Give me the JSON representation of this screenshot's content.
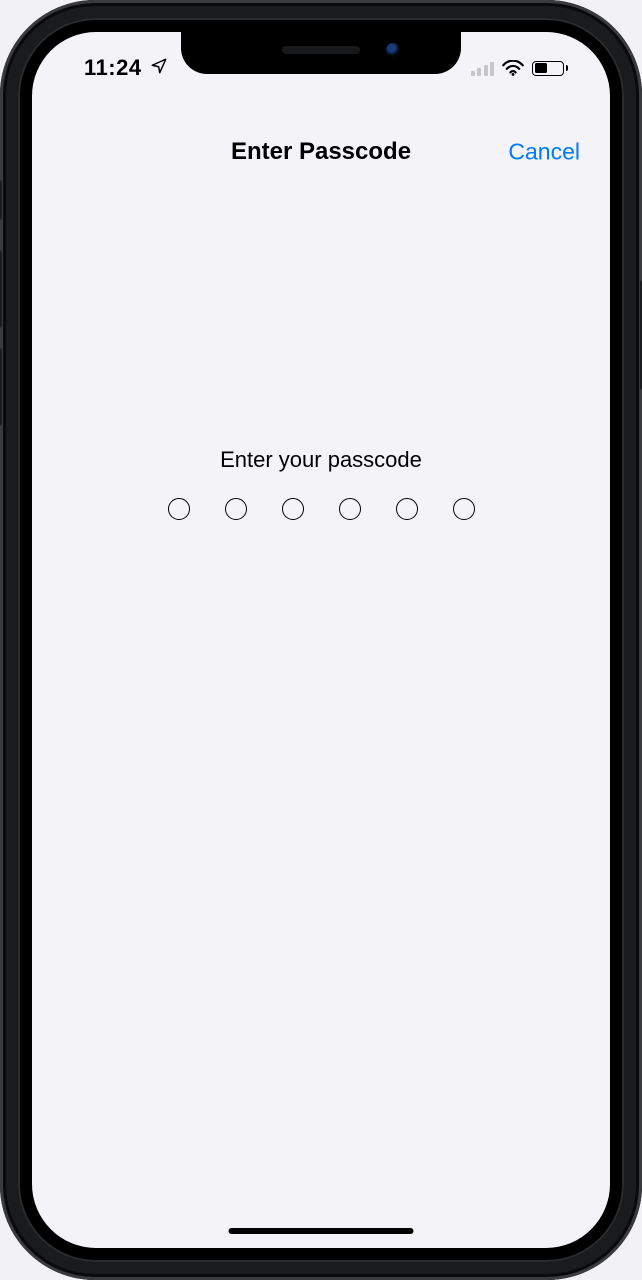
{
  "status": {
    "time": "11:24"
  },
  "navbar": {
    "title": "Enter Passcode",
    "cancel": "Cancel"
  },
  "body": {
    "prompt": "Enter your passcode",
    "passcode_length": 6,
    "passcode_filled": 0
  },
  "colors": {
    "accent": "#007aff",
    "bg": "#f4f3f8"
  }
}
